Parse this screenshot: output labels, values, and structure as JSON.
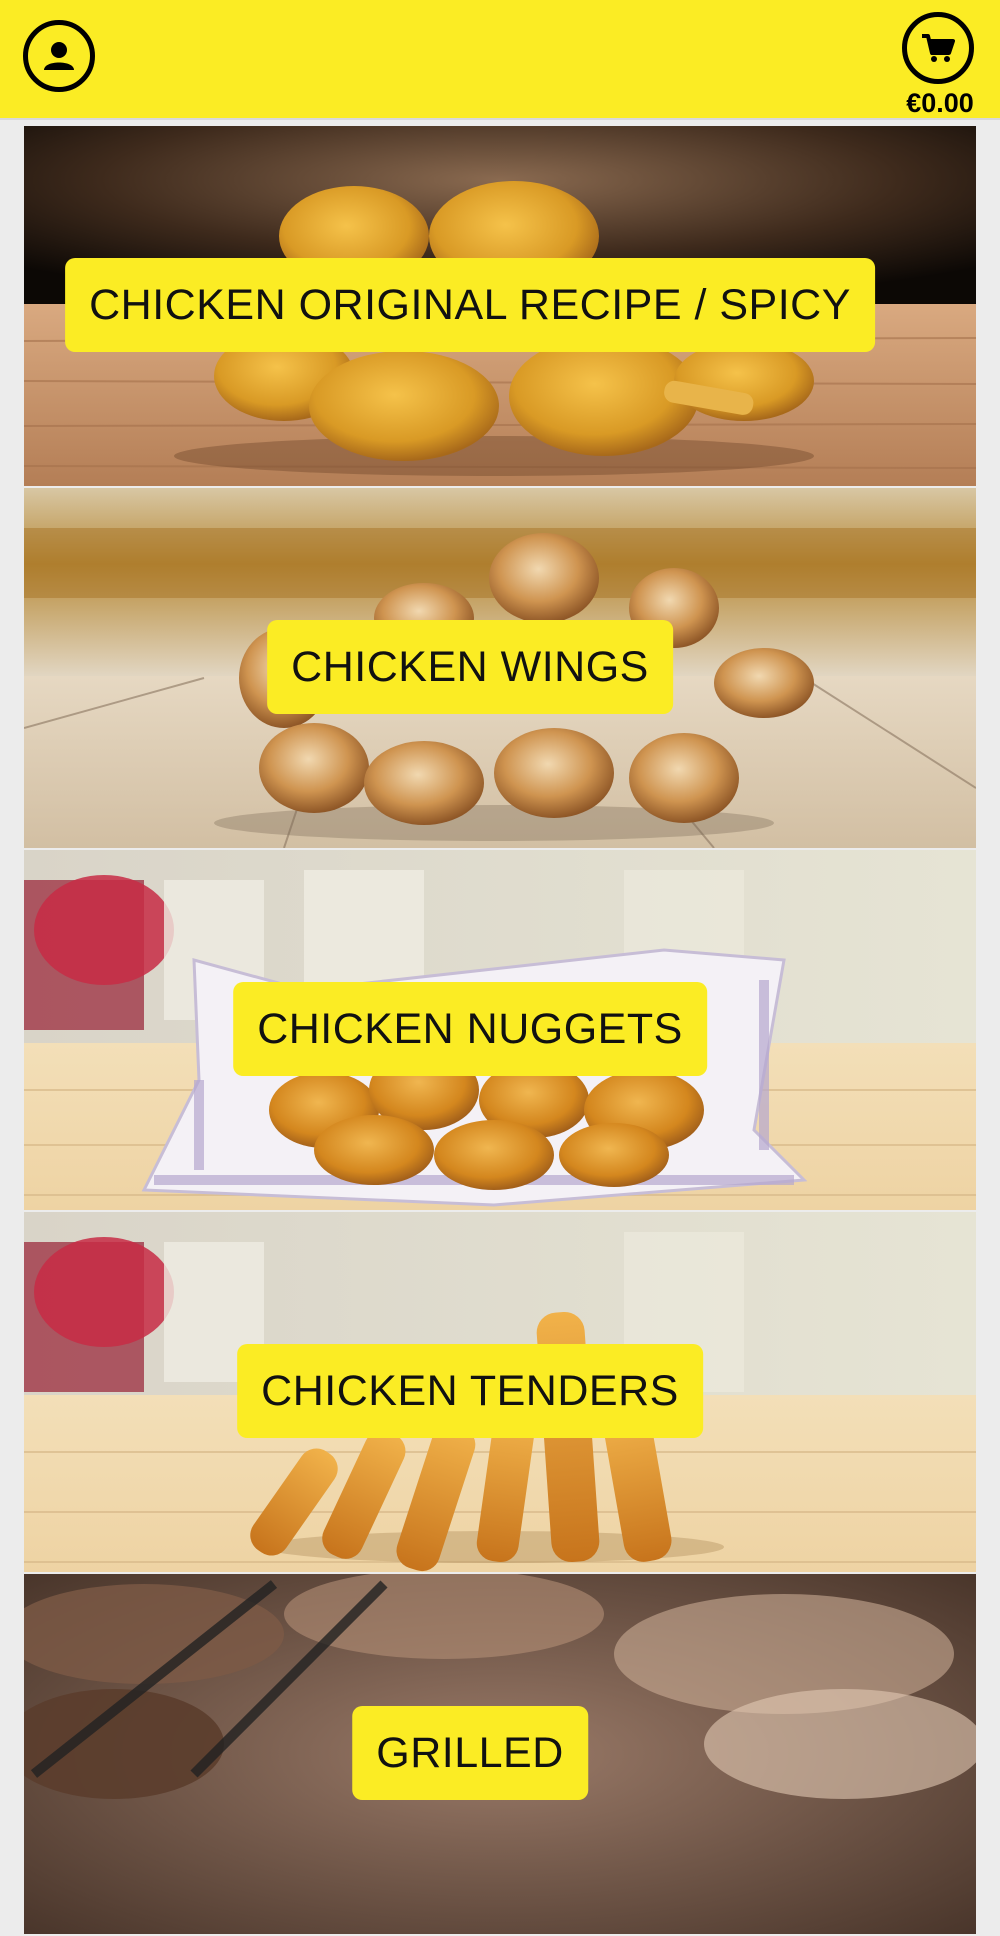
{
  "header": {
    "profile_icon": "user-icon",
    "cart_icon": "cart-icon",
    "cart_total": "€0.00"
  },
  "categories": [
    {
      "label": "CHICKEN ORIGINAL RECIPE / SPICY"
    },
    {
      "label": "CHICKEN WINGS"
    },
    {
      "label": "CHICKEN NUGGETS"
    },
    {
      "label": "CHICKEN TENDERS"
    },
    {
      "label": "GRILLED"
    }
  ],
  "colors": {
    "brand_yellow": "#fbec24",
    "text": "#111111"
  }
}
